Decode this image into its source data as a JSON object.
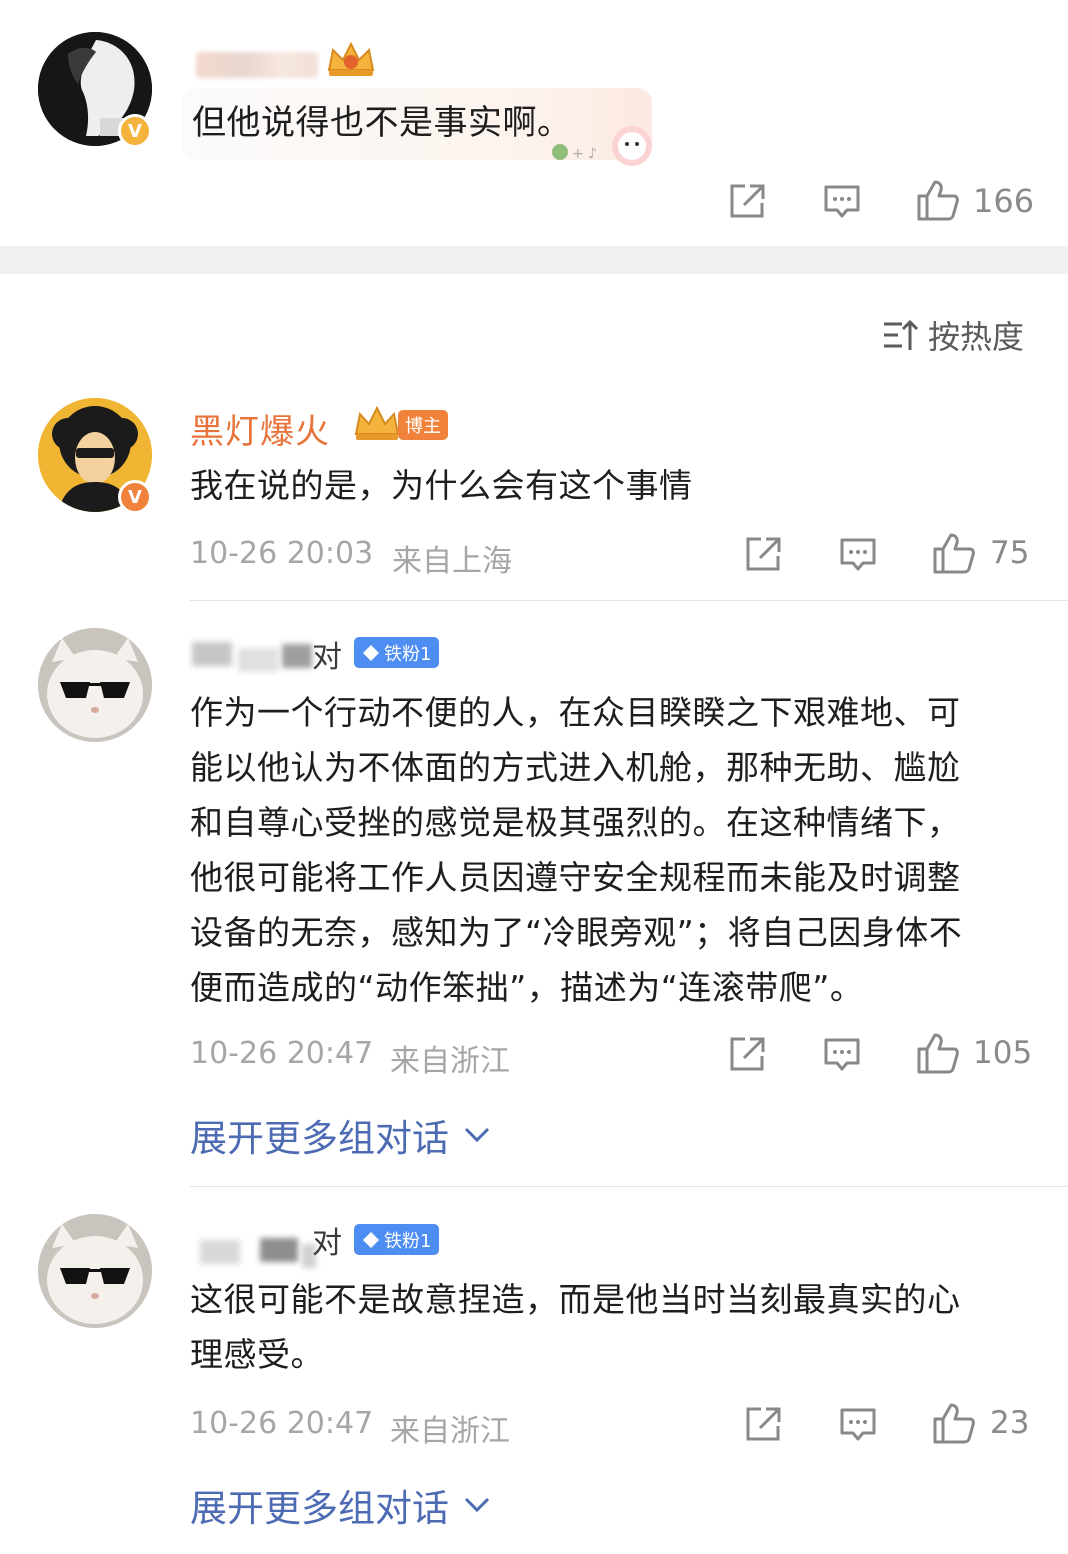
{
  "sort": {
    "label": "按热度"
  },
  "actions": {
    "expand_label": "展开更多组对话"
  },
  "comments": [
    {
      "content": "但他说得也不是事实啊。",
      "likes": "166",
      "verified": "V"
    },
    {
      "username": "黑灯爆火",
      "badge": "博主",
      "content": "我在说的是，为什么会有这个事情",
      "time": "10-26 20:03",
      "location": "来自上海",
      "likes": "75",
      "verified": "V"
    },
    {
      "badge": "铁粉1",
      "name_fragment": "对",
      "content_lines": [
        "作为一个行动不便的人，在众目睽睽之下艰难地、可",
        "能以他认为不体面的方式进入机舱，那种无助、尴尬",
        "和自尊心受挫的感觉是极其强烈的。在这种情绪下，",
        "他很可能将工作人员因遵守安全规程而未能及时调整",
        "设备的无奈，感知为了“冷眼旁观”；将自己因身体不",
        "便而造成的“动作笨拙”，描述为“连滚带爬”。"
      ],
      "time": "10-26 20:47",
      "location": "来自浙江",
      "likes": "105"
    },
    {
      "badge": "铁粉1",
      "name_fragment": "对",
      "content_lines": [
        "这很可能不是故意捏造，而是他当时当刻最真实的心",
        "理感受。"
      ],
      "time": "10-26 20:47",
      "location": "来自浙江",
      "likes": "23"
    }
  ],
  "colors": {
    "accent_orange": "#e8743b",
    "link_blue": "#4d6bb3",
    "badge_blue": "#4e8df1",
    "vip_gold": "#f3b33d"
  }
}
